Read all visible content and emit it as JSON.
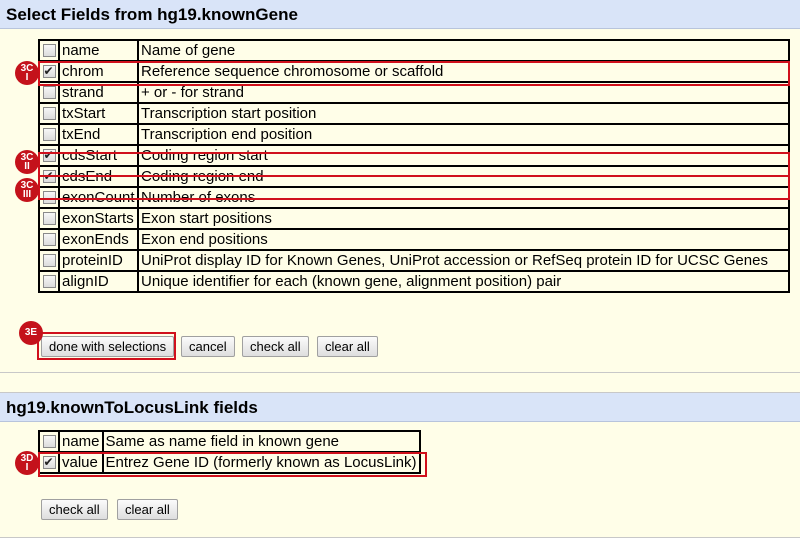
{
  "panel1": {
    "title": "Select Fields from hg19.knownGene",
    "rows": [
      {
        "name": "name",
        "desc": "Name of gene",
        "checked": false
      },
      {
        "name": "chrom",
        "desc": "Reference sequence chromosome or scaffold",
        "checked": true
      },
      {
        "name": "strand",
        "desc": "+ or - for strand",
        "checked": false
      },
      {
        "name": "txStart",
        "desc": "Transcription start position",
        "checked": false
      },
      {
        "name": "txEnd",
        "desc": "Transcription end position",
        "checked": false
      },
      {
        "name": "cdsStart",
        "desc": "Coding region start",
        "checked": true
      },
      {
        "name": "cdsEnd",
        "desc": "Coding region end",
        "checked": true
      },
      {
        "name": "exonCount",
        "desc": "Number of exons",
        "checked": false
      },
      {
        "name": "exonStarts",
        "desc": "Exon start positions",
        "checked": false
      },
      {
        "name": "exonEnds",
        "desc": "Exon end positions",
        "checked": false
      },
      {
        "name": "proteinID",
        "desc": "UniProt display ID for Known Genes, UniProt accession or RefSeq protein ID for UCSC Genes",
        "checked": false
      },
      {
        "name": "alignID",
        "desc": "Unique identifier for each (known gene, alignment position) pair",
        "checked": false
      }
    ],
    "buttons": {
      "done": "done with selections",
      "cancel": "cancel",
      "check_all": "check all",
      "clear_all": "clear all"
    }
  },
  "panel2": {
    "title": "hg19.knownToLocusLink fields",
    "rows": [
      {
        "name": "name",
        "desc": "Same as name field in known gene",
        "checked": false
      },
      {
        "name": "value",
        "desc": "Entrez Gene ID (formerly known as LocusLink)",
        "checked": true
      }
    ],
    "buttons": {
      "check_all": "check all",
      "clear_all": "clear all"
    }
  },
  "markers": {
    "m1": {
      "top": "3C",
      "bottom": "I"
    },
    "m2": {
      "top": "3C",
      "bottom": "II"
    },
    "m3": {
      "top": "3C",
      "bottom": "III"
    },
    "m4": {
      "top": "3E",
      "bottom": ""
    },
    "m5": {
      "top": "3D",
      "bottom": "I"
    }
  },
  "colors": {
    "accent": "#d0101c",
    "header_bg": "#d9e4f8",
    "page_bg": "#fffee8"
  }
}
